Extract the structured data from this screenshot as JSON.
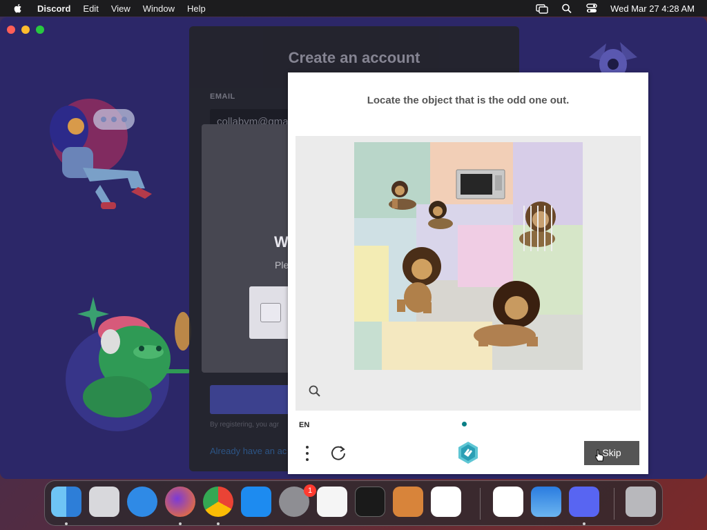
{
  "menubar": {
    "app_name": "Discord",
    "menus": [
      "Edit",
      "View",
      "Window",
      "Help"
    ],
    "clock": "Wed Mar 27  4:28 AM"
  },
  "register": {
    "title": "Create an account",
    "email_label": "EMAIL",
    "email_value": "collabvm@gma",
    "terms_text": "By registering, you agr",
    "login_link": "Already have an ac"
  },
  "verify": {
    "heading": "W",
    "subtitle": "Ple"
  },
  "captcha": {
    "prompt": "Locate the object that is the odd one out.",
    "language": "EN",
    "skip_label": "Skip"
  },
  "dock": {
    "apps": [
      "Finder",
      "Launchpad",
      "Safari",
      "Firefox",
      "Chrome",
      "App Store",
      "System Settings",
      "TextEdit",
      "Terminal",
      "GarageBand",
      "VS Code",
      "Visual Studio",
      "Weather",
      "Discord",
      "Trash"
    ],
    "settings_badge": "1"
  },
  "colors": {
    "discord_bg": "#2c2768",
    "hcaptcha_teal": "#0a7f86",
    "skip_button": "#555555"
  }
}
